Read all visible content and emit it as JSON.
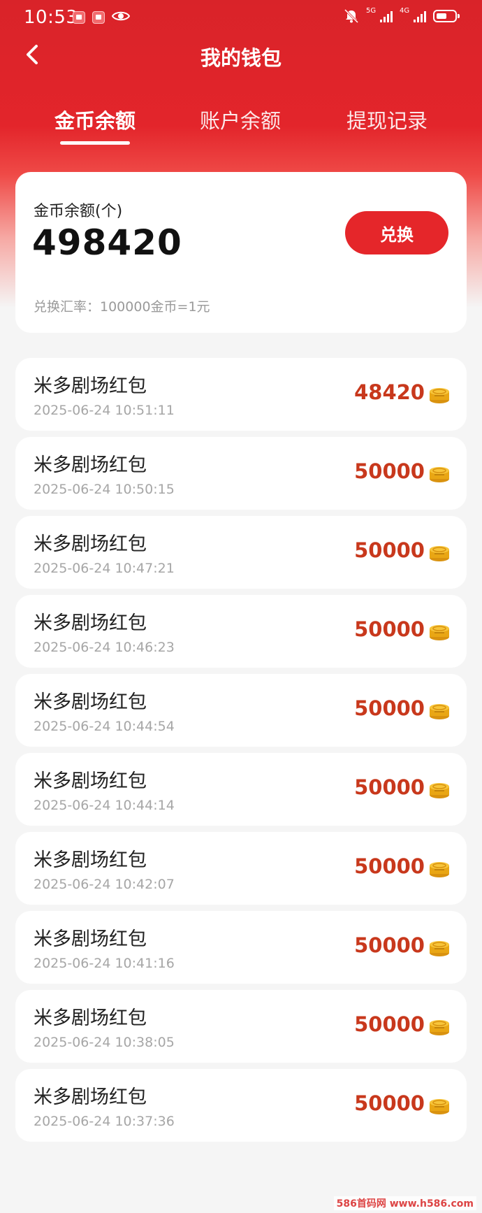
{
  "status_bar": {
    "time": "10:53",
    "network_1": "5G",
    "network_2": "4G"
  },
  "nav": {
    "title": "我的钱包",
    "back_icon": "chevron-left-icon"
  },
  "tabs": [
    {
      "label": "金币余额",
      "active": true
    },
    {
      "label": "账户余额",
      "active": false
    },
    {
      "label": "提现记录",
      "active": false
    }
  ],
  "balance": {
    "label": "金币余额(个)",
    "value": "498420",
    "exchange_button": "兑换",
    "rate_text": "兑换汇率：100000金币=1元"
  },
  "records": [
    {
      "title": "米多剧场红包",
      "time": "2025-06-24 10:51:11",
      "amount": "48420"
    },
    {
      "title": "米多剧场红包",
      "time": "2025-06-24 10:50:15",
      "amount": "50000"
    },
    {
      "title": "米多剧场红包",
      "time": "2025-06-24 10:47:21",
      "amount": "50000"
    },
    {
      "title": "米多剧场红包",
      "time": "2025-06-24 10:46:23",
      "amount": "50000"
    },
    {
      "title": "米多剧场红包",
      "time": "2025-06-24 10:44:54",
      "amount": "50000"
    },
    {
      "title": "米多剧场红包",
      "time": "2025-06-24 10:44:14",
      "amount": "50000"
    },
    {
      "title": "米多剧场红包",
      "time": "2025-06-24 10:42:07",
      "amount": "50000"
    },
    {
      "title": "米多剧场红包",
      "time": "2025-06-24 10:41:16",
      "amount": "50000"
    },
    {
      "title": "米多剧场红包",
      "time": "2025-06-24 10:38:05",
      "amount": "50000"
    },
    {
      "title": "米多剧场红包",
      "time": "2025-06-24 10:37:36",
      "amount": "50000"
    }
  ],
  "watermark": "586首码网 www.h586.com",
  "colors": {
    "brand_red": "#e5262a",
    "amount_red": "#c8381c",
    "coin_gold": "#f2b418"
  }
}
